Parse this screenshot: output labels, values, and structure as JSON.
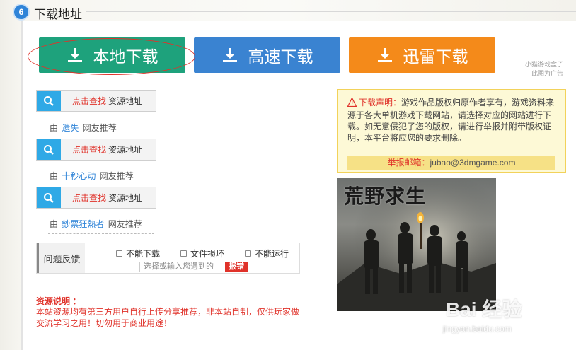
{
  "section": {
    "number": "6",
    "title": "下载地址"
  },
  "download_buttons": [
    {
      "label": "本地下载",
      "color": "#1ea27c"
    },
    {
      "label": "高速下载",
      "color": "#3a83d1"
    },
    {
      "label": "迅雷下载",
      "color": "#f48a1a"
    }
  ],
  "ad_note": {
    "line1": "小猫游戏盒子",
    "line2": "此图为广告"
  },
  "sources": [
    {
      "action": "点击查找",
      "label": "资源地址",
      "by": "由",
      "nick": "遗失",
      "suffix": "网友推荐"
    },
    {
      "action": "点击查找",
      "label": "资源地址",
      "by": "由",
      "nick": "十秒心动",
      "suffix": "网友推荐"
    },
    {
      "action": "点击查找",
      "label": "资源地址",
      "by": "由",
      "nick": "鈔票狂熱者",
      "suffix": "网友推荐"
    }
  ],
  "feedback": {
    "label": "问题反馈",
    "options": [
      "不能下载",
      "文件损坏",
      "不能运行"
    ],
    "input_placeholder": "选择或输入您遇到的",
    "report_button": "报错"
  },
  "resource_note": {
    "title": "资源说明 ：",
    "body": "本站资源均有第三方用户自行上传分享推荐，非本站自制，仅供玩家做交流学习之用！切勿用于商业用途！"
  },
  "notice": {
    "head": "下载声明：",
    "body": "游戏作品版权归原作者享有，游戏资料来源于各大单机游戏下载网站，请选择对应的网站进行下载。如无意侵犯了您的版权，请进行举报并附带版权证明，本平台将应您的要求删除。",
    "mail_key": "举报邮箱：",
    "mail_value": "jubao@3dmgame.com"
  },
  "poster": {
    "title": "荒野求生"
  },
  "watermark": {
    "text": "Bai 经验",
    "url": "jingyan.baidu.com"
  },
  "colors": {
    "accent_blue": "#2f84d8",
    "red": "#e0322a",
    "notice_bg": "#fdf9d6"
  }
}
